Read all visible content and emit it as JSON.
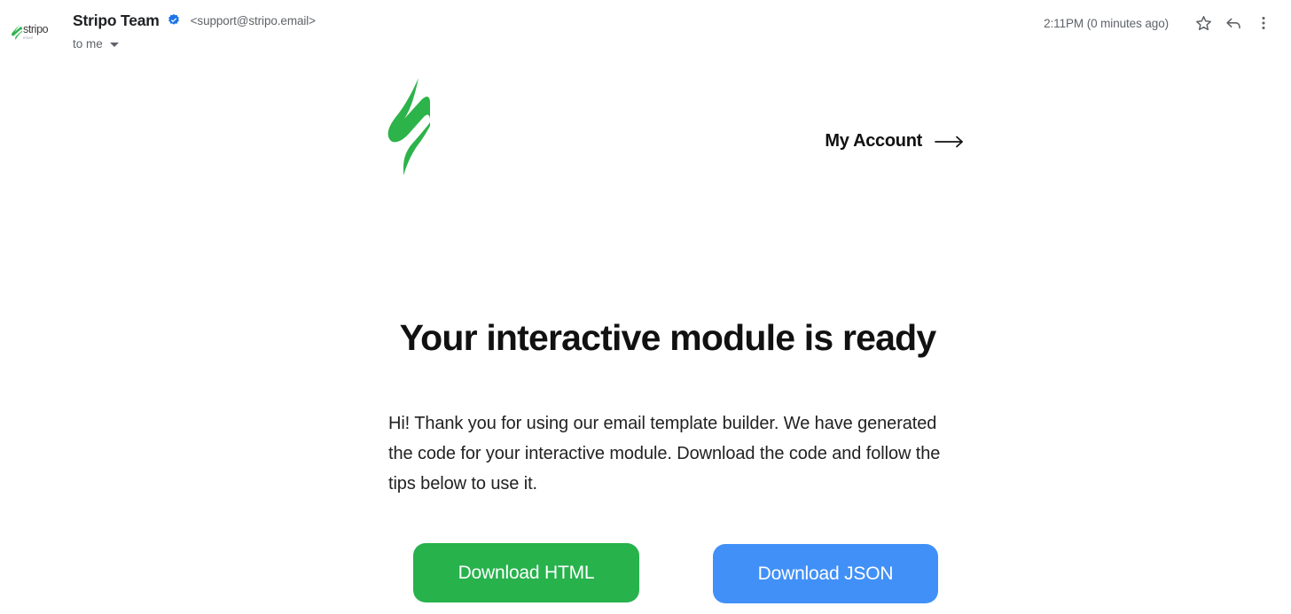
{
  "mail_header": {
    "avatar": {
      "wordmark": "stripo",
      "sub_wordmark": "email",
      "icon": "stripo-logo-icon"
    },
    "sender_name": "Stripo Team",
    "verified_icon": "verified-badge-icon",
    "sender_email": "<support@stripo.email>",
    "recipient": "to me",
    "recipient_caret_icon": "chevron-down-icon",
    "timestamp": "2:11PM (0 minutes ago)",
    "actions": [
      {
        "name": "star-icon",
        "label": "Star"
      },
      {
        "name": "reply-icon",
        "label": "Reply"
      },
      {
        "name": "more-options-icon",
        "label": "More"
      }
    ]
  },
  "email": {
    "brand": {
      "logo_icon": "stripo-s-logo-icon",
      "logo_color": "#2CB34A"
    },
    "account_link": {
      "label": "My Account",
      "arrow_icon": "arrow-right-icon"
    },
    "headline": "Your interactive module is ready",
    "body_text": "Hi! Thank you for using our email template builder. We have generated the code for your interactive module. Download the code and follow the tips below to use it.",
    "buttons": [
      {
        "label": "Download HTML",
        "name": "download-html-button",
        "color": "#27B24C",
        "text_color": "#FFFFFF"
      },
      {
        "label": "Download JSON",
        "name": "download-json-button",
        "color": "#4190F7",
        "text_color": "#FFFFFF"
      }
    ]
  },
  "colors": {
    "background": "#FFFFFF",
    "brand_green": "#2CB34A",
    "accent_blue": "#4190F7",
    "text_primary": "#202124",
    "text_secondary": "#5F6368",
    "verified_blue": "#1A73E8"
  }
}
